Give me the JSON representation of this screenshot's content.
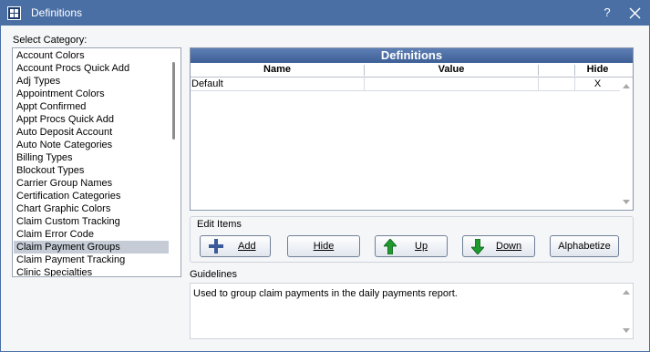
{
  "window": {
    "title": "Definitions",
    "help_label": "?",
    "icon": "grid-app-icon"
  },
  "category": {
    "label": "Select Category:",
    "items": [
      "Account Colors",
      "Account Procs Quick Add",
      "Adj Types",
      "Appointment Colors",
      "Appt Confirmed",
      "Appt Procs Quick Add",
      "Auto Deposit Account",
      "Auto Note Categories",
      "Billing Types",
      "Blockout Types",
      "Carrier Group Names",
      "Certification Categories",
      "Chart Graphic Colors",
      "Claim Custom Tracking",
      "Claim Error Code",
      "Claim Payment Groups",
      "Claim Payment Tracking",
      "Clinic Specialties"
    ],
    "selected": "Claim Payment Groups"
  },
  "definitions": {
    "title": "Definitions",
    "columns": [
      "Name",
      "Value",
      "Hide"
    ],
    "rows": [
      {
        "name": "Default",
        "value": "",
        "hide": "X"
      }
    ]
  },
  "edit_items": {
    "label": "Edit Items",
    "add_label": "Add",
    "hide_label": "Hide",
    "up_label": "Up",
    "down_label": "Down",
    "alphabetize_label": "Alphabetize"
  },
  "guidelines": {
    "label": "Guidelines",
    "text": "Used to group claim payments in the daily payments report."
  },
  "colors": {
    "titlebar": "#4a6fa5",
    "selection": "#c5ccd6",
    "grid_header": "#4d6fa5",
    "arrow_green": "#1e9a2e",
    "plus_blue": "#3a5a9a"
  }
}
